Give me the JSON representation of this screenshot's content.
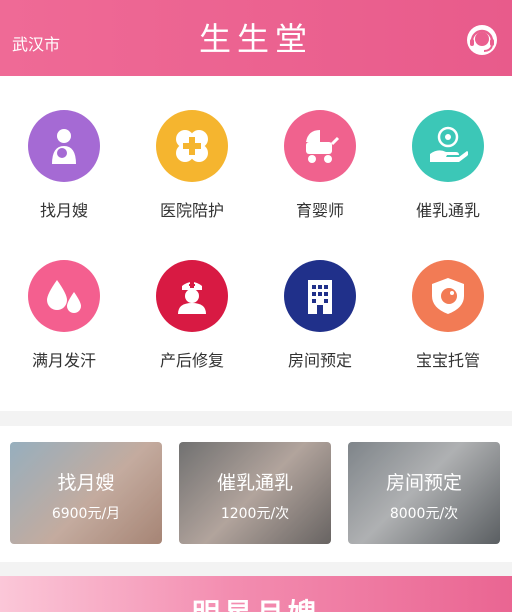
{
  "header": {
    "city": "武汉市",
    "brand": "生生堂",
    "service_icon": "headset-icon"
  },
  "services": [
    {
      "label": "找月嫂",
      "icon": "mother-baby-icon",
      "color": "#a56ad4"
    },
    {
      "label": "医院陪护",
      "icon": "medical-cross-icon",
      "color": "#f5b52f"
    },
    {
      "label": "育婴师",
      "icon": "baby-stroller-icon",
      "color": "#f0628e"
    },
    {
      "label": "催乳通乳",
      "icon": "hand-care-icon",
      "color": "#3cc7b7"
    },
    {
      "label": "满月发汗",
      "icon": "drops-icon",
      "color": "#f45f8f"
    },
    {
      "label": "产后修复",
      "icon": "nurse-icon",
      "color": "#d81a43"
    },
    {
      "label": "房间预定",
      "icon": "building-icon",
      "color": "#20308a"
    },
    {
      "label": "宝宝托管",
      "icon": "baby-shield-icon",
      "color": "#f27b55"
    }
  ],
  "cards": [
    {
      "title": "找月嫂",
      "price": "6900元/月"
    },
    {
      "title": "催乳通乳",
      "price": "1200元/次"
    },
    {
      "title": "房间预定",
      "price": "8000元/次"
    }
  ],
  "banner": {
    "title": "明星月嫂"
  }
}
